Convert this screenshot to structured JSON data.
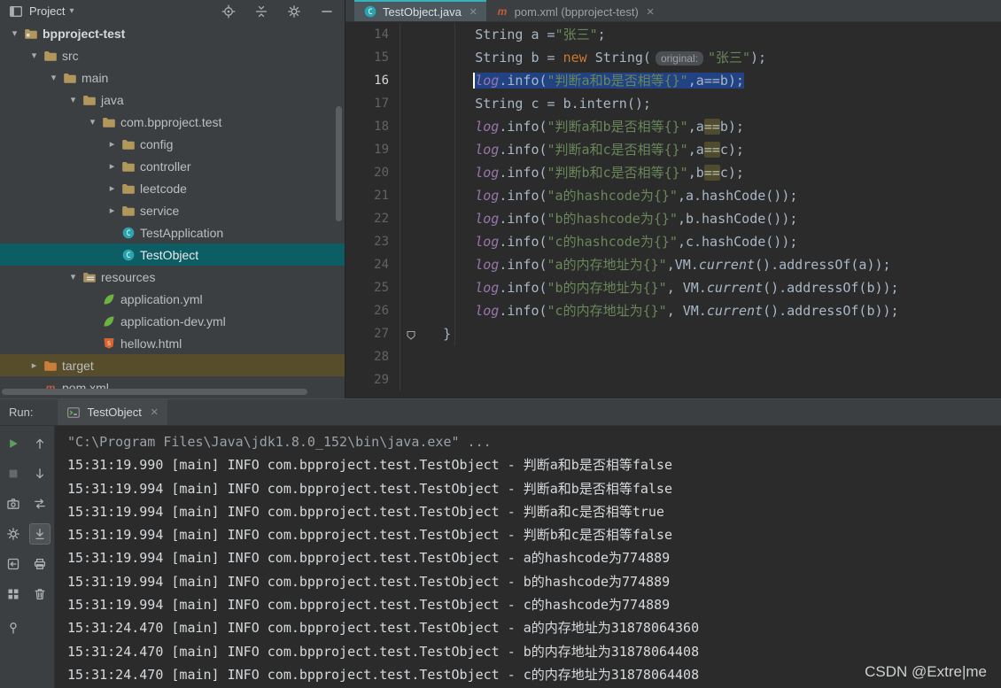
{
  "colors": {
    "accent_teal": "#36B3BA",
    "selection_blue": "#214283",
    "tree_selection": "#0D5D64",
    "excluded_row": "#574D2B"
  },
  "project_panel": {
    "title": "Project",
    "header_icons": [
      "locate-icon",
      "collapse-all-icon",
      "settings-icon",
      "hide-panel-icon"
    ],
    "tree": [
      {
        "label": "bpproject-test",
        "depth": 0,
        "arrow": "down",
        "icon": "project-folder",
        "root": true
      },
      {
        "label": "src",
        "depth": 1,
        "arrow": "down",
        "icon": "folder"
      },
      {
        "label": "main",
        "depth": 2,
        "arrow": "down",
        "icon": "folder"
      },
      {
        "label": "java",
        "depth": 3,
        "arrow": "down",
        "icon": "folder"
      },
      {
        "label": "com.bpproject.test",
        "depth": 4,
        "arrow": "down",
        "icon": "package"
      },
      {
        "label": "config",
        "depth": 5,
        "arrow": "right",
        "icon": "package"
      },
      {
        "label": "controller",
        "depth": 5,
        "arrow": "right",
        "icon": "package"
      },
      {
        "label": "leetcode",
        "depth": 5,
        "arrow": "right",
        "icon": "package"
      },
      {
        "label": "service",
        "depth": 5,
        "arrow": "right",
        "icon": "package"
      },
      {
        "label": "TestApplication",
        "depth": 5,
        "arrow": null,
        "icon": "class"
      },
      {
        "label": "TestObject",
        "depth": 5,
        "arrow": null,
        "icon": "class",
        "selected": true
      },
      {
        "label": "resources",
        "depth": 3,
        "arrow": "down",
        "icon": "resources"
      },
      {
        "label": "application.yml",
        "depth": 4,
        "arrow": null,
        "icon": "leaf"
      },
      {
        "label": "application-dev.yml",
        "depth": 4,
        "arrow": null,
        "icon": "leaf"
      },
      {
        "label": "hellow.html",
        "depth": 4,
        "arrow": null,
        "icon": "html"
      },
      {
        "label": "target",
        "depth": 1,
        "arrow": "right",
        "icon": "folder-excluded",
        "row": "excluded"
      },
      {
        "label": "pom.xml",
        "depth": 1,
        "arrow": null,
        "icon": "maven"
      }
    ]
  },
  "editor": {
    "tabs": [
      {
        "label": "TestObject.java",
        "icon": "class",
        "active": true
      },
      {
        "label": "pom.xml (bpproject-test)",
        "icon": "maven",
        "active": false
      }
    ],
    "lines": [
      {
        "num": "14",
        "segments": [
          {
            "t": "        String a =",
            "c": "p"
          },
          {
            "t": "\"张三\"",
            "c": "s"
          },
          {
            "t": ";",
            "c": "p"
          }
        ]
      },
      {
        "num": "15",
        "segments": [
          {
            "t": "        String b = ",
            "c": "p"
          },
          {
            "t": "new",
            "c": "k"
          },
          {
            "t": " String(",
            "c": "p"
          },
          {
            "t": "original:",
            "c": "h"
          },
          {
            "t": "\"张三\"",
            "c": "s"
          },
          {
            "t": ");",
            "c": "p"
          }
        ]
      },
      {
        "num": "16",
        "selected": true,
        "segments": [
          {
            "t": "        ",
            "c": "p"
          },
          {
            "t": "log",
            "c": "f",
            "sel": true,
            "caret": true
          },
          {
            "t": ".info(",
            "c": "p",
            "sel": true
          },
          {
            "t": "\"判断a和b是否相等{}\"",
            "c": "s",
            "sel": true
          },
          {
            "t": ",a==b);",
            "c": "p",
            "sel": true
          }
        ]
      },
      {
        "num": "17",
        "segments": [
          {
            "t": "        String c = b.intern();",
            "c": "p"
          }
        ]
      },
      {
        "num": "18",
        "segments": [
          {
            "t": "        ",
            "c": "p"
          },
          {
            "t": "log",
            "c": "f"
          },
          {
            "t": ".info(",
            "c": "p"
          },
          {
            "t": "\"判断a和b是否相等{}\"",
            "c": "s"
          },
          {
            "t": ",a",
            "c": "p"
          },
          {
            "t": "==",
            "c": "o"
          },
          {
            "t": "b);",
            "c": "p"
          }
        ]
      },
      {
        "num": "19",
        "segments": [
          {
            "t": "        ",
            "c": "p"
          },
          {
            "t": "log",
            "c": "f"
          },
          {
            "t": ".info(",
            "c": "p"
          },
          {
            "t": "\"判断a和c是否相等{}\"",
            "c": "s"
          },
          {
            "t": ",a",
            "c": "p"
          },
          {
            "t": "==",
            "c": "o"
          },
          {
            "t": "c);",
            "c": "p"
          }
        ]
      },
      {
        "num": "20",
        "segments": [
          {
            "t": "        ",
            "c": "p"
          },
          {
            "t": "log",
            "c": "f"
          },
          {
            "t": ".info(",
            "c": "p"
          },
          {
            "t": "\"判断b和c是否相等{}\"",
            "c": "s"
          },
          {
            "t": ",b",
            "c": "p"
          },
          {
            "t": "==",
            "c": "o"
          },
          {
            "t": "c);",
            "c": "p"
          }
        ]
      },
      {
        "num": "21",
        "segments": [
          {
            "t": "        ",
            "c": "p"
          },
          {
            "t": "log",
            "c": "f"
          },
          {
            "t": ".info(",
            "c": "p"
          },
          {
            "t": "\"a的hashcode为{}\"",
            "c": "s"
          },
          {
            "t": ",a.hashCode());",
            "c": "p"
          }
        ]
      },
      {
        "num": "22",
        "segments": [
          {
            "t": "        ",
            "c": "p"
          },
          {
            "t": "log",
            "c": "f"
          },
          {
            "t": ".info(",
            "c": "p"
          },
          {
            "t": "\"b的hashcode为{}\"",
            "c": "s"
          },
          {
            "t": ",b.hashCode());",
            "c": "p"
          }
        ]
      },
      {
        "num": "23",
        "segments": [
          {
            "t": "        ",
            "c": "p"
          },
          {
            "t": "log",
            "c": "f"
          },
          {
            "t": ".info(",
            "c": "p"
          },
          {
            "t": "\"c的hashcode为{}\"",
            "c": "s"
          },
          {
            "t": ",c.hashCode());",
            "c": "p"
          }
        ]
      },
      {
        "num": "24",
        "segments": [
          {
            "t": "        ",
            "c": "p"
          },
          {
            "t": "log",
            "c": "f"
          },
          {
            "t": ".info(",
            "c": "p"
          },
          {
            "t": "\"a的内存地址为{}\"",
            "c": "s"
          },
          {
            "t": ",VM.",
            "c": "p"
          },
          {
            "t": "current",
            "c": "i"
          },
          {
            "t": "().addressOf(a));",
            "c": "p"
          }
        ]
      },
      {
        "num": "25",
        "segments": [
          {
            "t": "        ",
            "c": "p"
          },
          {
            "t": "log",
            "c": "f"
          },
          {
            "t": ".info(",
            "c": "p"
          },
          {
            "t": "\"b的内存地址为{}\"",
            "c": "s"
          },
          {
            "t": ", VM.",
            "c": "p"
          },
          {
            "t": "current",
            "c": "i"
          },
          {
            "t": "().addressOf(b));",
            "c": "p"
          }
        ]
      },
      {
        "num": "26",
        "segments": [
          {
            "t": "        ",
            "c": "p"
          },
          {
            "t": "log",
            "c": "f"
          },
          {
            "t": ".info(",
            "c": "p"
          },
          {
            "t": "\"c的内存地址为{}\"",
            "c": "s"
          },
          {
            "t": ", VM.",
            "c": "p"
          },
          {
            "t": "current",
            "c": "i"
          },
          {
            "t": "().addressOf(b));",
            "c": "p"
          }
        ]
      },
      {
        "num": "27",
        "marker": true,
        "segments": [
          {
            "t": "    }",
            "c": "p"
          }
        ]
      },
      {
        "num": "28",
        "segments": []
      },
      {
        "num": "29",
        "segments": []
      }
    ]
  },
  "run_panel": {
    "label": "Run:",
    "tab": {
      "label": "TestObject",
      "icon": "console"
    },
    "toolbar_left": [
      "rerun-icon",
      "stop-icon",
      "camera-icon",
      "run-settings-icon",
      "back-icon",
      "layout-grid-icon",
      "pin-icon"
    ],
    "toolbar_console": [
      "up-arrow-icon",
      "down-arrow-icon",
      "swap-arrows-icon",
      "scroll-to-end-icon",
      "print-icon",
      "clear-console-icon"
    ],
    "console": {
      "command": "\"C:\\Program Files\\Java\\jdk1.8.0_152\\bin\\java.exe\" ...",
      "logs": [
        "15:31:19.990 [main] INFO com.bpproject.test.TestObject - 判断a和b是否相等false",
        "15:31:19.994 [main] INFO com.bpproject.test.TestObject - 判断a和b是否相等false",
        "15:31:19.994 [main] INFO com.bpproject.test.TestObject - 判断a和c是否相等true",
        "15:31:19.994 [main] INFO com.bpproject.test.TestObject - 判断b和c是否相等false",
        "15:31:19.994 [main] INFO com.bpproject.test.TestObject - a的hashcode为774889",
        "15:31:19.994 [main] INFO com.bpproject.test.TestObject - b的hashcode为774889",
        "15:31:19.994 [main] INFO com.bpproject.test.TestObject - c的hashcode为774889",
        "15:31:24.470 [main] INFO com.bpproject.test.TestObject - a的内存地址为31878064360",
        "15:31:24.470 [main] INFO com.bpproject.test.TestObject - b的内存地址为31878064408",
        "15:31:24.470 [main] INFO com.bpproject.test.TestObject - c的内存地址为31878064408"
      ]
    }
  },
  "watermark": "CSDN @Extre|me"
}
